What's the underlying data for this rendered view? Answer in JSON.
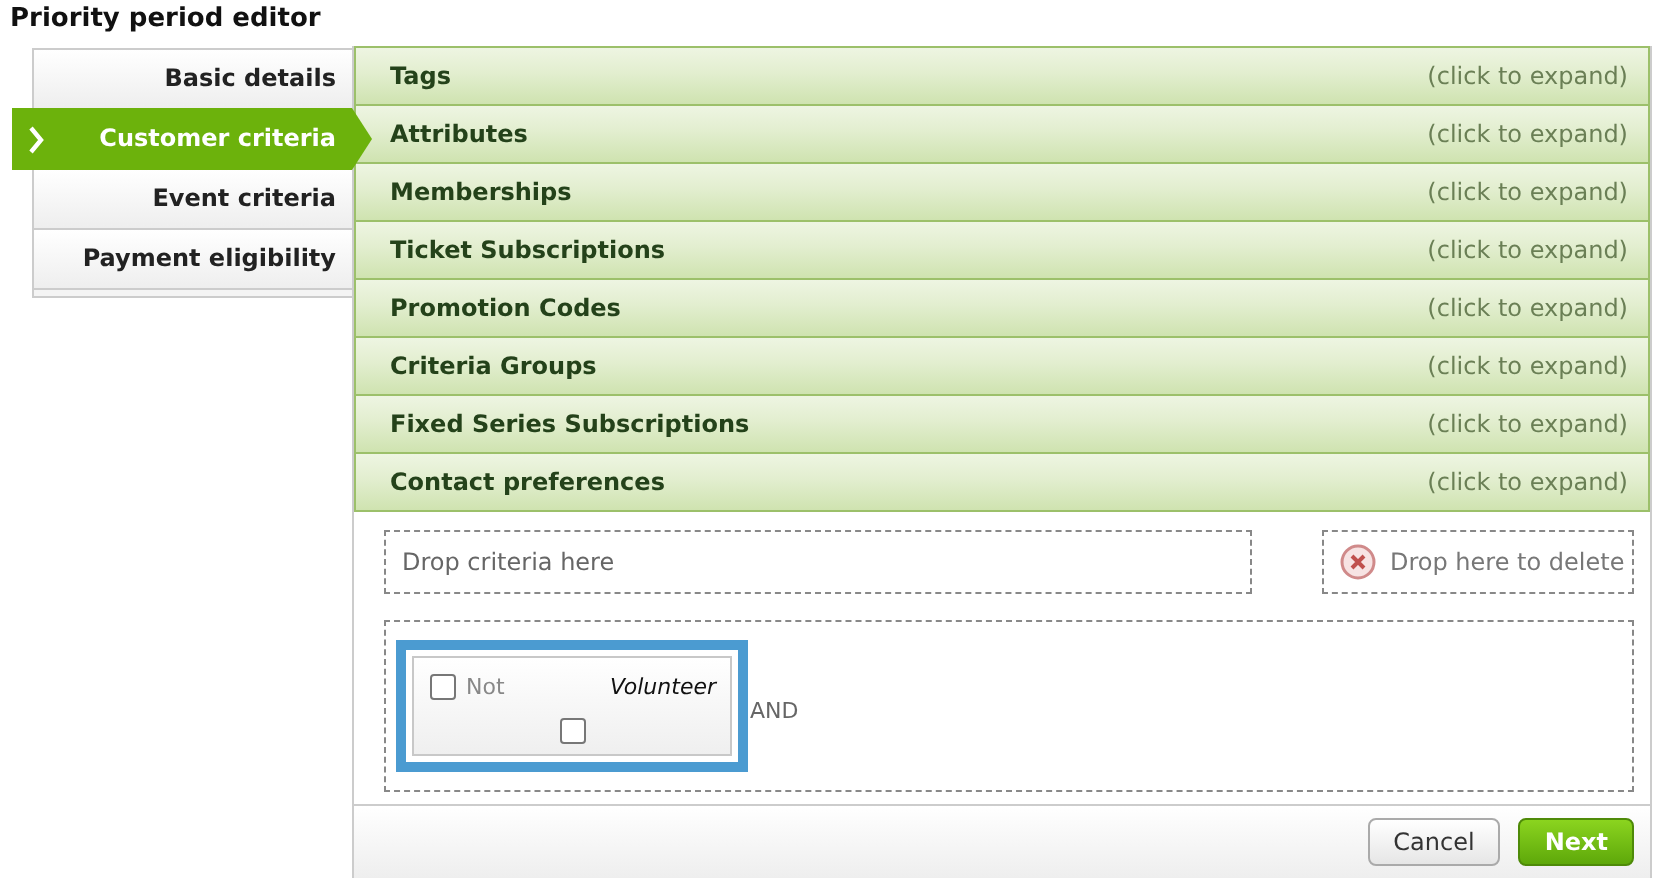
{
  "title": "Priority period editor",
  "sidebar": {
    "items": [
      {
        "label": "Basic details",
        "selected": false
      },
      {
        "label": "Customer criteria",
        "selected": true
      },
      {
        "label": "Event criteria",
        "selected": false
      },
      {
        "label": "Payment eligibility",
        "selected": false
      }
    ]
  },
  "sections": [
    {
      "title": "Tags",
      "hint": "(click to expand)"
    },
    {
      "title": "Attributes",
      "hint": "(click to expand)"
    },
    {
      "title": "Memberships",
      "hint": "(click to expand)"
    },
    {
      "title": "Ticket Subscriptions",
      "hint": "(click to expand)"
    },
    {
      "title": "Promotion Codes",
      "hint": "(click to expand)"
    },
    {
      "title": "Criteria Groups",
      "hint": "(click to expand)"
    },
    {
      "title": "Fixed Series Subscriptions",
      "hint": "(click to expand)"
    },
    {
      "title": "Contact preferences",
      "hint": "(click to expand)"
    }
  ],
  "drop_zone": "Drop criteria here",
  "delete_zone": "Drop here to delete",
  "criterion": {
    "not_label": "Not",
    "not_checked": false,
    "name": "Volunteer",
    "value_checked": false,
    "joiner": "AND"
  },
  "buttons": {
    "cancel": "Cancel",
    "next": "Next"
  }
}
